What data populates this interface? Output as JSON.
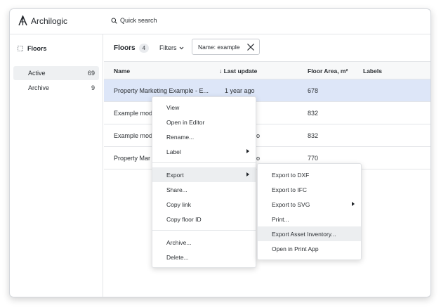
{
  "app": {
    "name": "Archilogic"
  },
  "search": {
    "label": "Quick search"
  },
  "sidebar": {
    "title": "Floors",
    "items": [
      {
        "label": "Active",
        "count": "69"
      },
      {
        "label": "Archive",
        "count": "9"
      }
    ]
  },
  "header": {
    "title": "Floors",
    "count": "4",
    "filters_label": "Filters",
    "filter_chip": "Name: example"
  },
  "table": {
    "columns": [
      "Name",
      "↓ Last update",
      "Floor Area, m²",
      "Labels"
    ],
    "rows": [
      {
        "name": "Property Marketing Example - E...",
        "last_update": "1 year ago",
        "area": "678"
      },
      {
        "name": "Example mod",
        "last_update": "",
        "area": "832"
      },
      {
        "name": "Example mod",
        "last_update": "o",
        "area": "832"
      },
      {
        "name": "Property Mar",
        "last_update": "o",
        "area": "770"
      }
    ]
  },
  "context_menu": {
    "group1": [
      "View",
      "Open in Editor",
      "Rename...",
      "Label"
    ],
    "group2": [
      "Export",
      "Share...",
      "Copy link",
      "Copy floor ID"
    ],
    "group3": [
      "Archive...",
      "Delete..."
    ]
  },
  "export_submenu": {
    "items": [
      "Export to DXF",
      "Export to IFC",
      "Export to SVG",
      "Print...",
      "Export Asset Inventory...",
      "Open in Print App"
    ]
  },
  "colors": {
    "selected_row": "#dde6f8",
    "hover": "#eceef0",
    "border": "#e3e5e8"
  }
}
